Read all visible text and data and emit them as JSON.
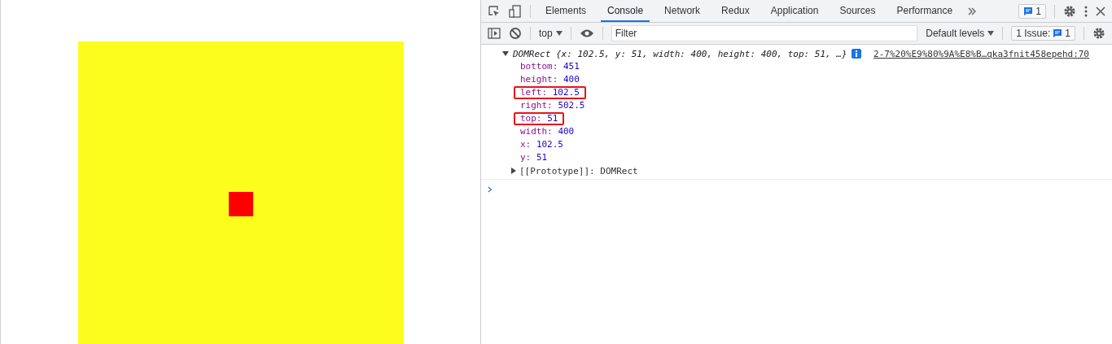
{
  "devtools": {
    "tabs": [
      {
        "label": "Elements",
        "selected": false
      },
      {
        "label": "Console",
        "selected": true
      },
      {
        "label": "Network",
        "selected": false
      },
      {
        "label": "Redux",
        "selected": false
      },
      {
        "label": "Application",
        "selected": false
      },
      {
        "label": "Sources",
        "selected": false
      },
      {
        "label": "Performance",
        "selected": false
      }
    ],
    "message_badge": "1",
    "console_toolbar": {
      "context": "top",
      "filter": {
        "placeholder": "Filter"
      },
      "levels": "Default levels",
      "issues": {
        "label": "1 Issue:",
        "count": "1"
      }
    },
    "entry": {
      "expanded": true,
      "summary": "DOMRect {x: 102.5, y: 51, width: 400, height: 400, top: 51, …}",
      "source": "2-7%20%E9%80%9A%E8%B…qka3fnit458epehd:70",
      "properties": [
        {
          "key": "bottom:",
          "value": "451",
          "highlighted": false
        },
        {
          "key": "height:",
          "value": "400",
          "highlighted": false
        },
        {
          "key": "left:",
          "value": "102.5",
          "highlighted": true
        },
        {
          "key": "right:",
          "value": "502.5",
          "highlighted": false
        },
        {
          "key": "top:",
          "value": "51",
          "highlighted": true
        },
        {
          "key": "width:",
          "value": "400",
          "highlighted": false
        },
        {
          "key": "x:",
          "value": "102.5",
          "highlighted": false
        },
        {
          "key": "y:",
          "value": "51",
          "highlighted": false
        }
      ],
      "prototype": {
        "key": "[[Prototype]]:",
        "value": "DOMRect",
        "expanded": false
      }
    }
  }
}
